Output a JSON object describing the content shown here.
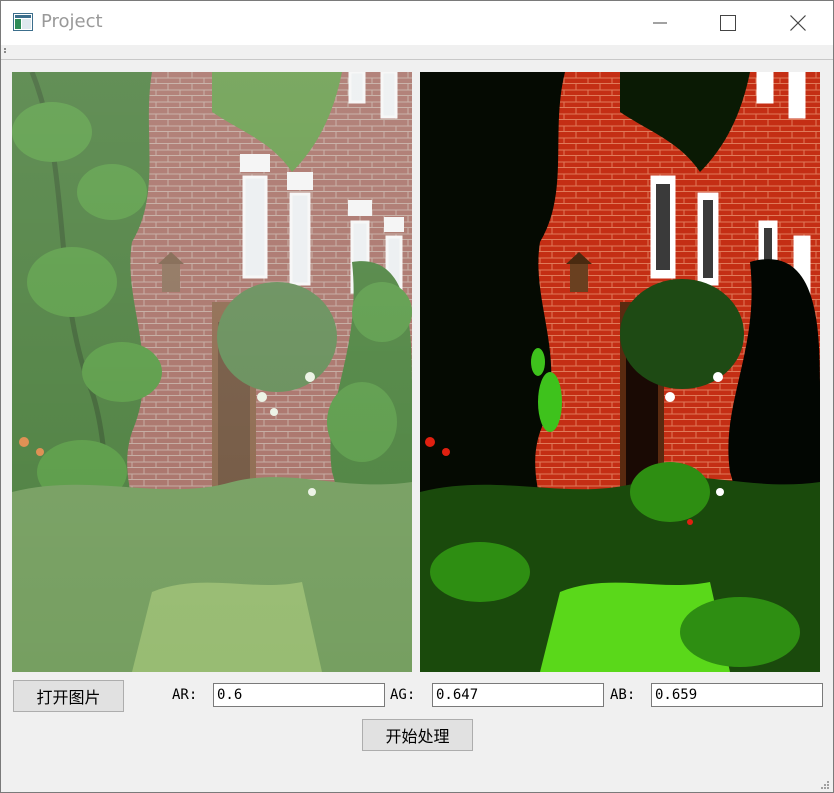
{
  "window": {
    "title": "Project",
    "icon": "app-window-icon",
    "controls": {
      "minimize_icon": "minimize-icon",
      "maximize_icon": "maximize-icon",
      "close_icon": "close-icon"
    }
  },
  "images": {
    "original": "original-foggy-photo",
    "processed": "processed-dehazed-photo"
  },
  "controls": {
    "open_button_label": "打开图片",
    "ar_label": "AR:",
    "ar_value": "0.6",
    "ag_label": "AG:",
    "ag_value": "0.647",
    "ab_label": "AB:",
    "ab_value": "0.659",
    "process_button_label": "开始处理"
  },
  "colors": {
    "title_text": "#999999",
    "button_bg": "#e1e1e1",
    "button_border": "#adadad",
    "window_bg": "#f0f0f0"
  }
}
